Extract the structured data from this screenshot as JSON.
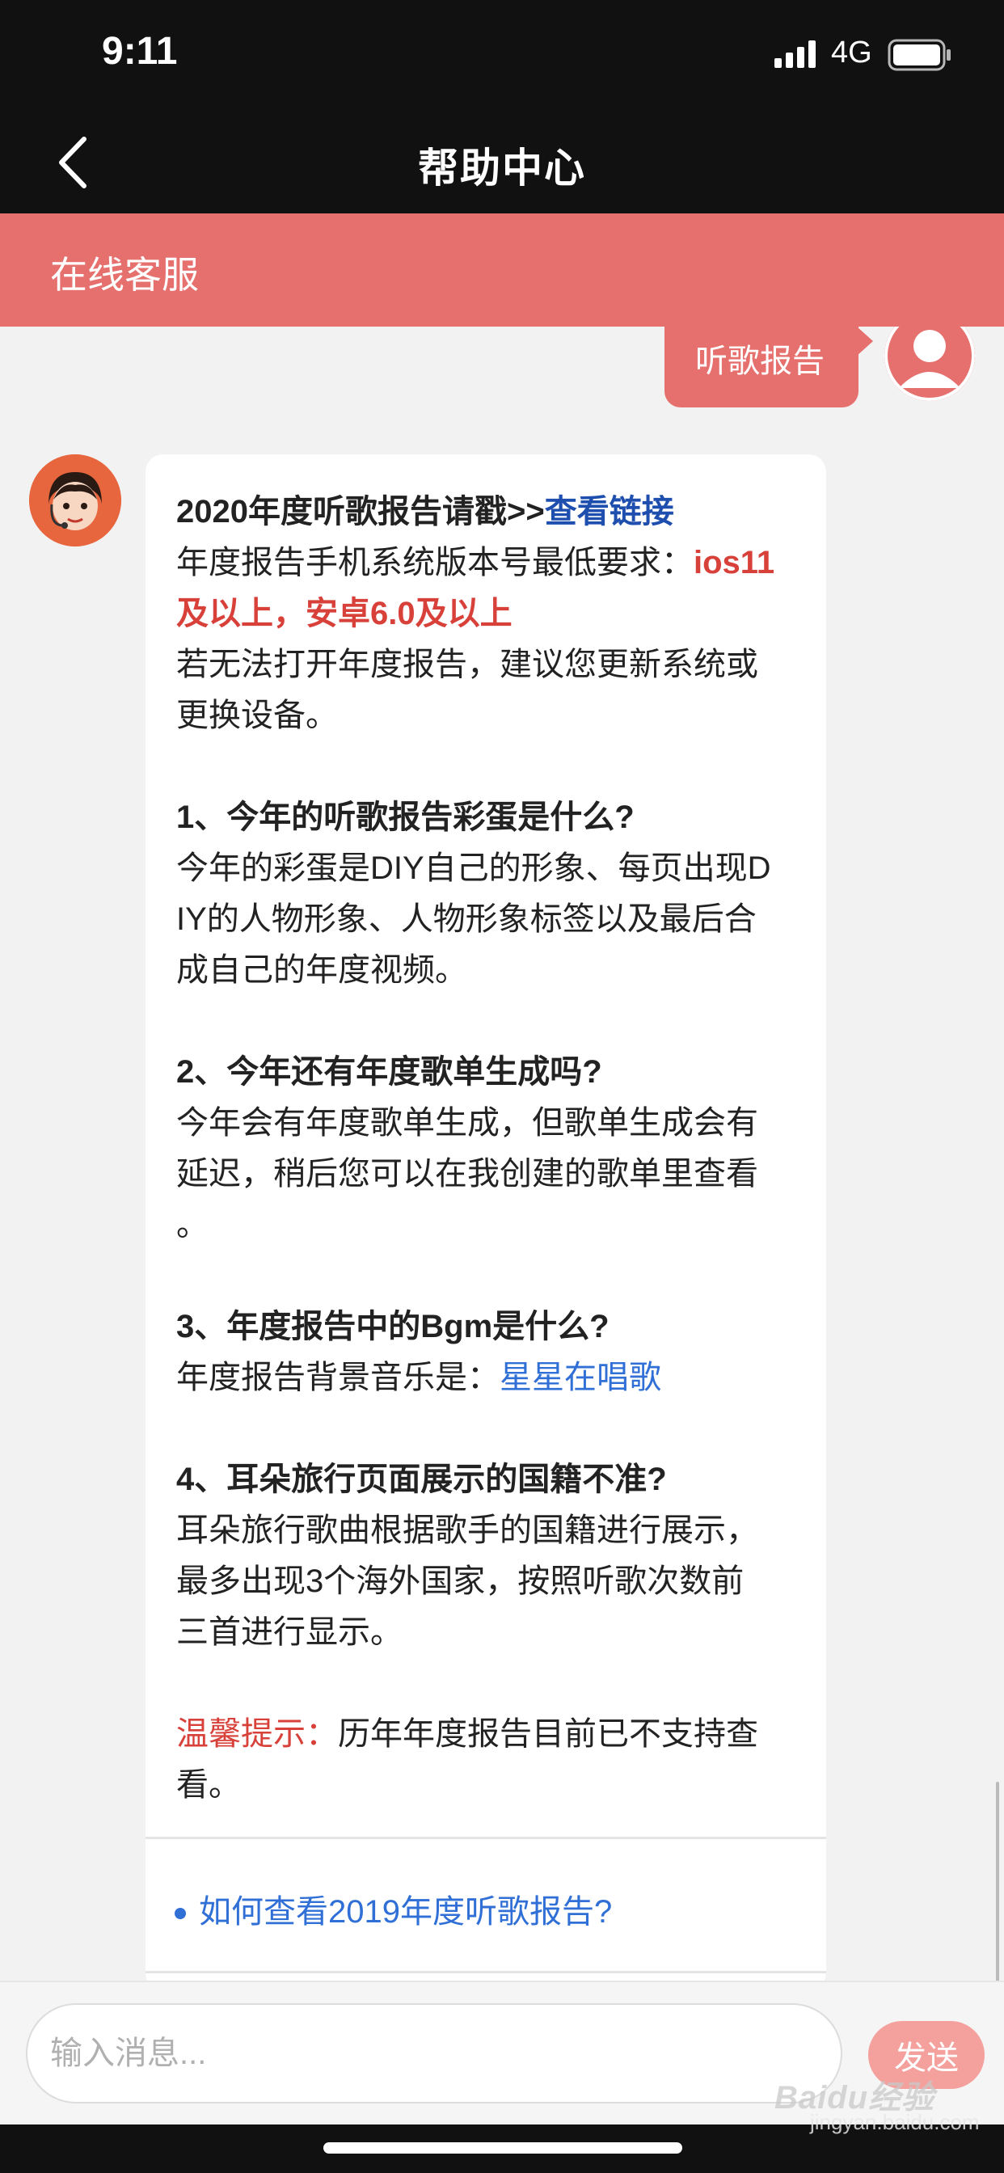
{
  "status_bar": {
    "time": "9:11",
    "network": "4G",
    "icons": [
      "signal-icon",
      "battery-icon"
    ]
  },
  "nav": {
    "title": "帮助中心",
    "back_icon": "chevron-left-icon"
  },
  "service_header": {
    "title": "在线客服"
  },
  "chat": {
    "user_message": "听歌报告",
    "bot_message": {
      "line1_prefix": "2020年度听歌报告请戳>>",
      "line1_link": "查看链接",
      "line2_prefix": "年度报告手机系统版本号最低要求：",
      "line2_red": "ios11",
      "line3_red": "及以上，安卓6.0及以上",
      "line4": "若无法打开年度报告，建议您更新系统或",
      "line5": "更换设备。",
      "q1_title": "1、今年的听歌报告彩蛋是什么?",
      "q1_line1": "今年的彩蛋是DIY自己的形象、每页出现D",
      "q1_line2": "IY的人物形象、人物形象标签以及最后合",
      "q1_line3": "成自己的年度视频。",
      "q2_title": "2、今年还有年度歌单生成吗?",
      "q2_line1": "今年会有年度歌单生成，但歌单生成会有",
      "q2_line2": "延迟，稍后您可以在我创建的歌单里查看",
      "q2_line3": "。",
      "q3_title": "3、年度报告中的Bgm是什么?",
      "q3_prefix": "年度报告背景音乐是：",
      "q3_link": "星星在唱歌",
      "q4_title": "4、耳朵旅行页面展示的国籍不准?",
      "q4_line1": "耳朵旅行歌曲根据歌手的国籍进行展示，",
      "q4_line2": "最多出现3个海外国家，按照听歌次数前",
      "q4_line3": "三首进行显示。",
      "tip_label": "温馨提示：",
      "tip_line1": "历年年度报告目前已不支持查",
      "tip_line2": "看。"
    },
    "related_question": "如何查看2019年度听歌报告?"
  },
  "input_bar": {
    "placeholder": "输入消息...",
    "send_label": "发送"
  },
  "watermark": {
    "logo": "Baidu经验",
    "text": "jingyan.baidu.com"
  },
  "colors": {
    "accent": "#e6706d",
    "link": "#2f6fd6",
    "link_dark": "#1f4fae",
    "warning_red": "#d8403a",
    "top_bar": "#111111"
  }
}
